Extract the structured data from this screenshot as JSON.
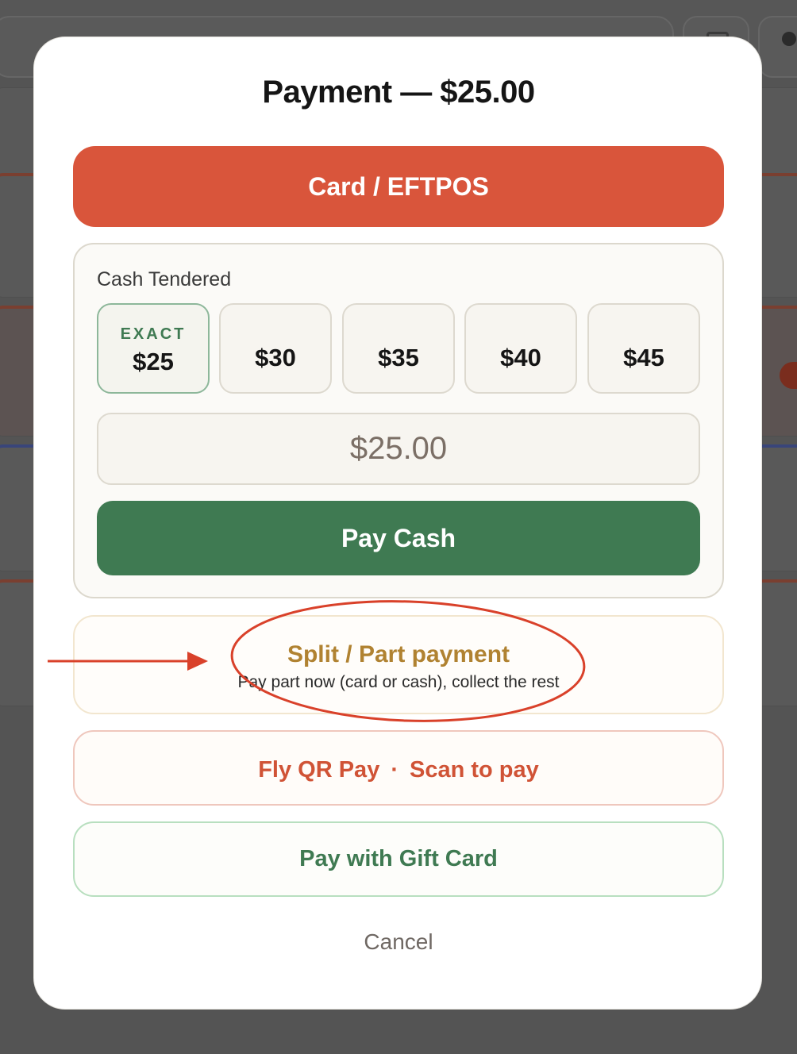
{
  "modal": {
    "title": "Payment — $25.00",
    "card_button_label": "Card / EFTPOS",
    "cash": {
      "label": "Cash Tendered",
      "exact_tag": "EXACT",
      "amounts": [
        "$25",
        "$30",
        "$35",
        "$40",
        "$45"
      ],
      "tendered_value": "$25.00",
      "pay_button_label": "Pay Cash"
    },
    "split": {
      "title": "Split / Part payment",
      "subtitle": "Pay part now (card or cash), collect the rest"
    },
    "qr": {
      "title": "Fly QR Pay",
      "separator": "·",
      "subtitle": "Scan to pay"
    },
    "gift_label": "Pay with Gift Card",
    "cancel_label": "Cancel"
  },
  "colors": {
    "card": "#d9553b",
    "cash": "#3f7a52",
    "split": "#b08231",
    "annotation": "#d9412a"
  }
}
